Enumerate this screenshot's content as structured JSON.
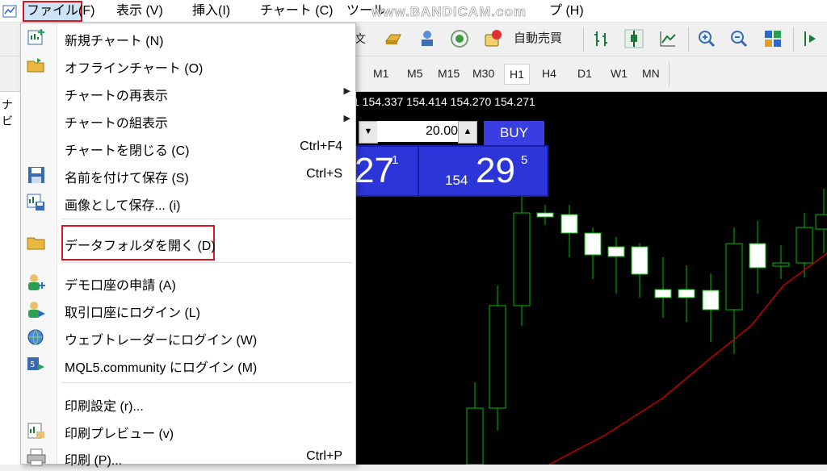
{
  "menubar": {
    "items": [
      "ファイル",
      "(F)",
      "表示 (V)",
      "挿入(I)",
      "チャート (C)",
      "ツール",
      "プ (H)"
    ],
    "watermark": "www.BANDICAM.com"
  },
  "toolbar": {
    "auto_trade_label": "自動売買",
    "order_fragment": "文"
  },
  "timeframes": [
    "M1",
    "M5",
    "M15",
    "M30",
    "H1",
    "H4",
    "D1",
    "W1",
    "MN"
  ],
  "active_timeframe": "H1",
  "left_panel": {
    "label": "ナビ"
  },
  "chart": {
    "ohlc_text": "1 154.337 154.414 154.270 154.271",
    "lot_value": "20.00",
    "buy_label": "BUY",
    "sell_price_big": "27",
    "sell_price_sup": "1",
    "buy_price_small": "154",
    "buy_price_big": "29",
    "buy_price_sup": "5",
    "colors": {
      "background": "#000000",
      "bull": "#00c000",
      "ma": "#c00000",
      "buy_panel": "#2b35d8"
    }
  },
  "file_menu": {
    "items": [
      {
        "label": "新規チャート (N)",
        "shortcut": "",
        "submenu": false,
        "icon": "new-chart-icon"
      },
      {
        "label": "オフラインチャート (O)",
        "shortcut": "",
        "submenu": false,
        "icon": "open-folder-icon"
      },
      {
        "label": "チャートの再表示",
        "shortcut": "",
        "submenu": true,
        "icon": ""
      },
      {
        "label": "チャートの組表示",
        "shortcut": "",
        "submenu": true,
        "icon": ""
      },
      {
        "label": "チャートを閉じる (C)",
        "shortcut": "Ctrl+F4",
        "submenu": false,
        "icon": ""
      },
      {
        "label": "名前を付けて保存 (S)",
        "shortcut": "Ctrl+S",
        "submenu": false,
        "icon": "save-icon"
      },
      {
        "label": "画像として保存... (i)",
        "shortcut": "",
        "submenu": false,
        "icon": "save-image-icon"
      },
      {
        "label": "データフォルダを開く (D)",
        "shortcut": "",
        "submenu": false,
        "icon": "folder-icon"
      },
      {
        "label": "デモ口座の申請 (A)",
        "shortcut": "",
        "submenu": false,
        "icon": "add-user-icon"
      },
      {
        "label": "取引口座にログイン (L)",
        "shortcut": "",
        "submenu": false,
        "icon": "login-user-icon"
      },
      {
        "label": "ウェブトレーダーにログイン (W)",
        "shortcut": "",
        "submenu": false,
        "icon": "globe-icon"
      },
      {
        "label": "MQL5.community にログイン (M)",
        "shortcut": "",
        "submenu": false,
        "icon": "mql5-icon"
      },
      {
        "label": "印刷設定 (r)...",
        "shortcut": "",
        "submenu": false,
        "icon": ""
      },
      {
        "label": "印刷プレビュー (v)",
        "shortcut": "",
        "submenu": false,
        "icon": "print-preview-icon"
      },
      {
        "label": "印刷 (P)...",
        "shortcut": "Ctrl+P",
        "submenu": false,
        "icon": "printer-icon"
      }
    ]
  }
}
